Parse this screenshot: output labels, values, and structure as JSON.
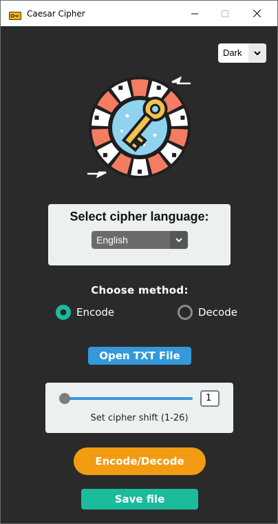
{
  "window": {
    "title": "Caesar Cipher",
    "icon": "key-app-icon",
    "controls": [
      "minimize-icon",
      "maximize-icon",
      "close-icon"
    ]
  },
  "theme_select": {
    "value": "Dark"
  },
  "logo": {
    "icon": "key-dial-icon"
  },
  "language": {
    "title": "Select cipher language:",
    "selected": "English"
  },
  "method": {
    "title": "Choose method:",
    "options": [
      {
        "label": "Encode",
        "selected": true
      },
      {
        "label": "Decode",
        "selected": false
      }
    ]
  },
  "open_button": {
    "label": "Open TXT File"
  },
  "shift": {
    "value": "1",
    "min": 1,
    "max": 26,
    "label": "Set cipher shift (1-26)"
  },
  "encode_button": {
    "label": "Encode/Decode"
  },
  "save_button": {
    "label": "Save file"
  },
  "colors": {
    "background": "#2a2a2a",
    "card": "#ecf0f1",
    "blue": "#3498db",
    "orange": "#f39c12",
    "teal": "#1abc9c"
  }
}
